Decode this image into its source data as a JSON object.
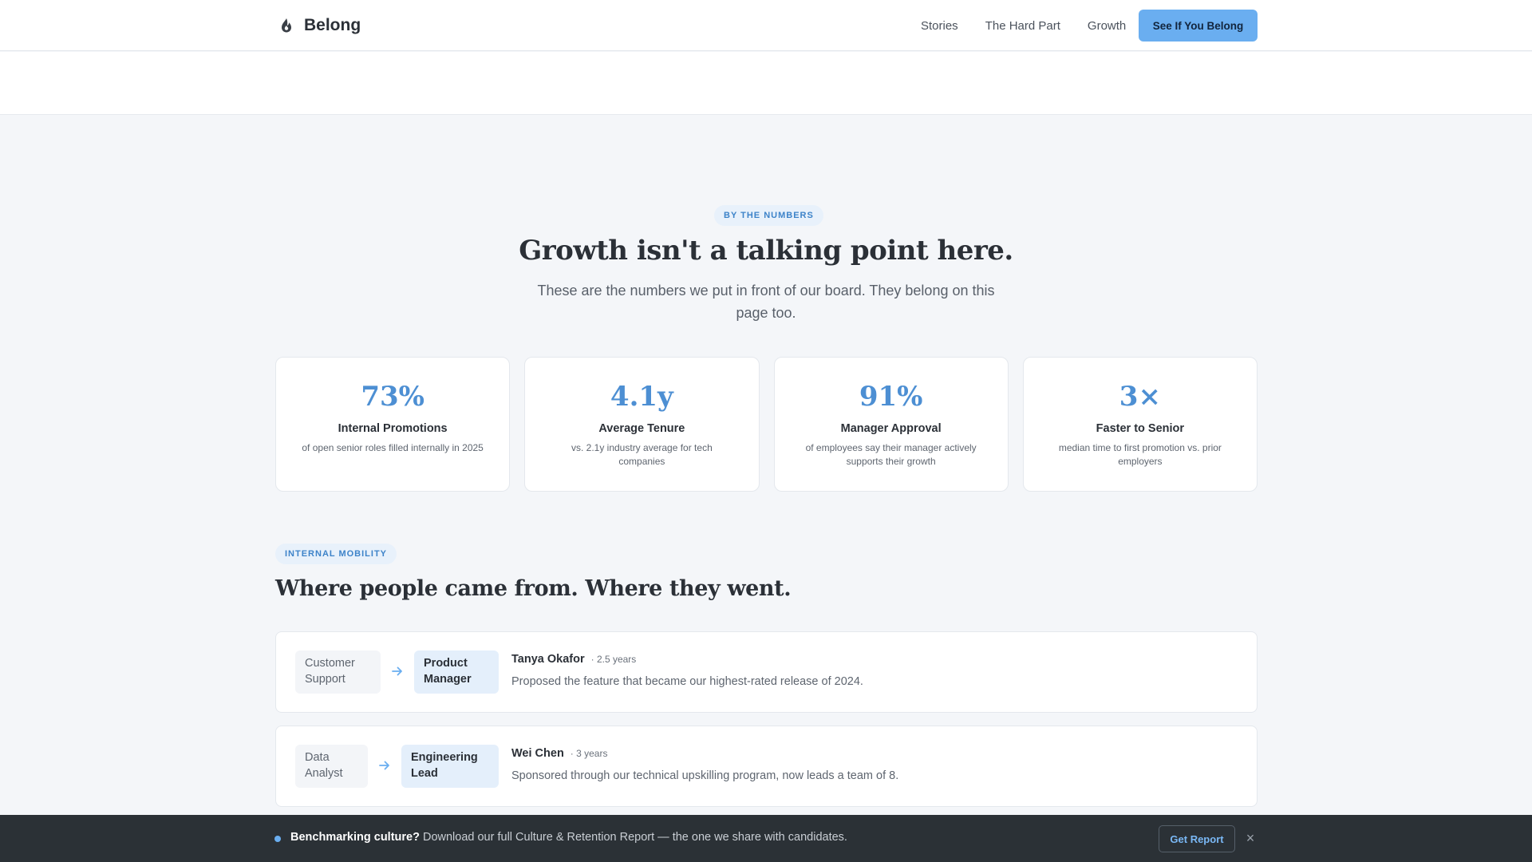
{
  "header": {
    "brand": "Belong",
    "nav": [
      "Stories",
      "The Hard Part",
      "Growth"
    ],
    "cta": "See If You Belong"
  },
  "numbers": {
    "eyebrow": "BY THE NUMBERS",
    "title": "Growth isn't a talking point here.",
    "subtitle": "These are the numbers we put in front of our board. They belong on this page too.",
    "stats": [
      {
        "value": "73%",
        "label": "Internal Promotions",
        "desc": "of open senior roles filled internally in 2025"
      },
      {
        "value": "4.1y",
        "label": "Average Tenure",
        "desc": "vs. 2.1y industry average for tech companies"
      },
      {
        "value": "91%",
        "label": "Manager Approval",
        "desc": "of employees say their manager actively supports their growth"
      },
      {
        "value": "3×",
        "label": "Faster to Senior",
        "desc": "median time to first promotion vs. prior employers"
      }
    ]
  },
  "mobility": {
    "eyebrow": "INTERNAL MOBILITY",
    "title": "Where people came from. Where they went.",
    "moves": [
      {
        "from": "Customer Support",
        "to": "Product Manager",
        "name": "Tanya Okafor",
        "tenure": "· 2.5 years",
        "desc": "Proposed the feature that became our highest-rated release of 2024."
      },
      {
        "from": "Data Analyst",
        "to": "Engineering Lead",
        "name": "Wei Chen",
        "tenure": "· 3 years",
        "desc": "Sponsored through our technical upskilling program, now leads a team of 8."
      }
    ]
  },
  "banner": {
    "lead": "Benchmarking culture?",
    "text": " Download our full Culture & Retention Report — the one we share with candidates.",
    "button": "Get Report",
    "close": "×"
  },
  "colors": {
    "accent": "#6aaef0",
    "stat_value": "#4d8fd3",
    "banner_bg": "#2b3136"
  }
}
